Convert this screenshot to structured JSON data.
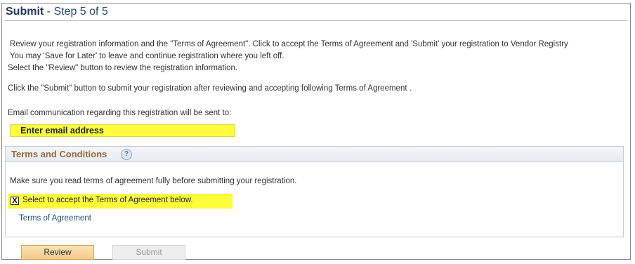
{
  "header": {
    "title_strong": "Submit",
    "title_rest": " - Step 5 of 5"
  },
  "instructions": {
    "line1": "Review your registration information and the \"Terms of Agreement\". Click to accept the Terms of Agreement and 'Submit' your registration to Vendor Registry",
    "line2": "You may 'Save for Later' to leave and continue registration where you left off.",
    "line3": "Select the \"Review\" button to review the registration information.",
    "line4": "Click the \"Submit\" button to submit your registration after reviewing and accepting following Terms of Agreement .",
    "line5": "Email communication regarding this registration will be sent to:"
  },
  "email": {
    "value": "Enter email address"
  },
  "terms": {
    "title": "Terms and Conditions",
    "help_glyph": "?",
    "note": "Make sure you read terms of agreement fully before submitting your registration.",
    "accept_mark": "X",
    "accept_label": "Select to accept the Terms of Agreement below.",
    "agreement_link": "Terms of Agreement"
  },
  "buttons": {
    "review": "Review",
    "submit": "Submit"
  },
  "colors": {
    "highlight": "#fdfd3c",
    "title": "#22365c",
    "section_title": "#9a6a3a",
    "link": "#1a4a8a"
  }
}
